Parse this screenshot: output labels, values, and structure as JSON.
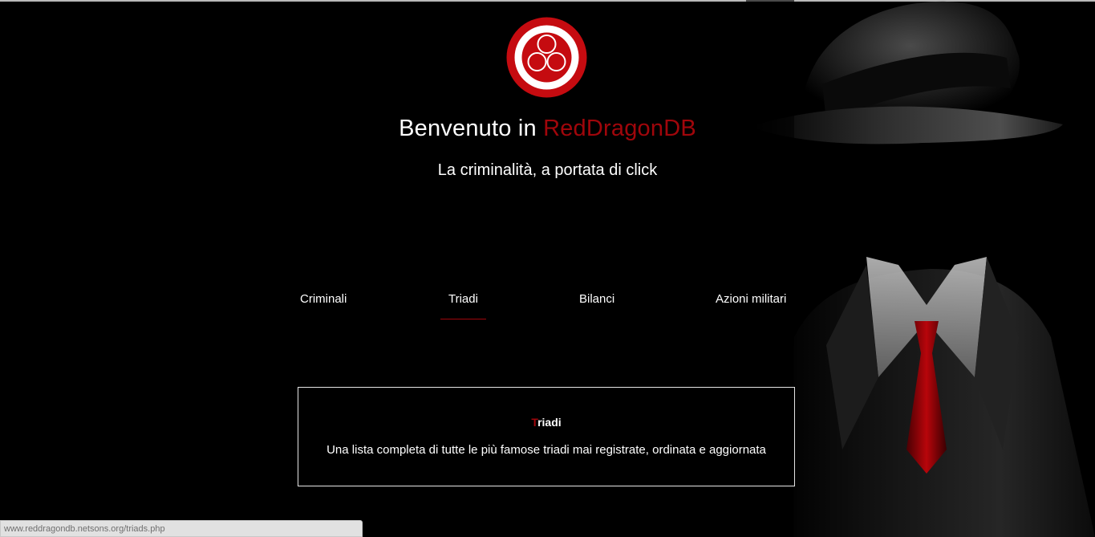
{
  "header": {
    "welcome_prefix": "Benvenuto in ",
    "brand": "RedDragonDB",
    "tagline": "La criminalità, a portata di click"
  },
  "nav": {
    "items": [
      {
        "label": "Criminali",
        "active": false
      },
      {
        "label": "Triadi",
        "active": true
      },
      {
        "label": "Bilanci",
        "active": false
      },
      {
        "label": "Azioni militari",
        "active": false
      }
    ]
  },
  "card": {
    "title_first_letter": "T",
    "title_rest": "riadi",
    "description": "Una lista completa di tutte le più famose triadi mai registrate, ordinata e aggiornata"
  },
  "statusbar": {
    "url": "www.reddragondb.netsons.org/triads.php"
  },
  "colors": {
    "accent": "#a0060b",
    "background": "#000000",
    "text": "#ffffff"
  },
  "icons": {
    "logo": "three-circles-logo-icon"
  }
}
